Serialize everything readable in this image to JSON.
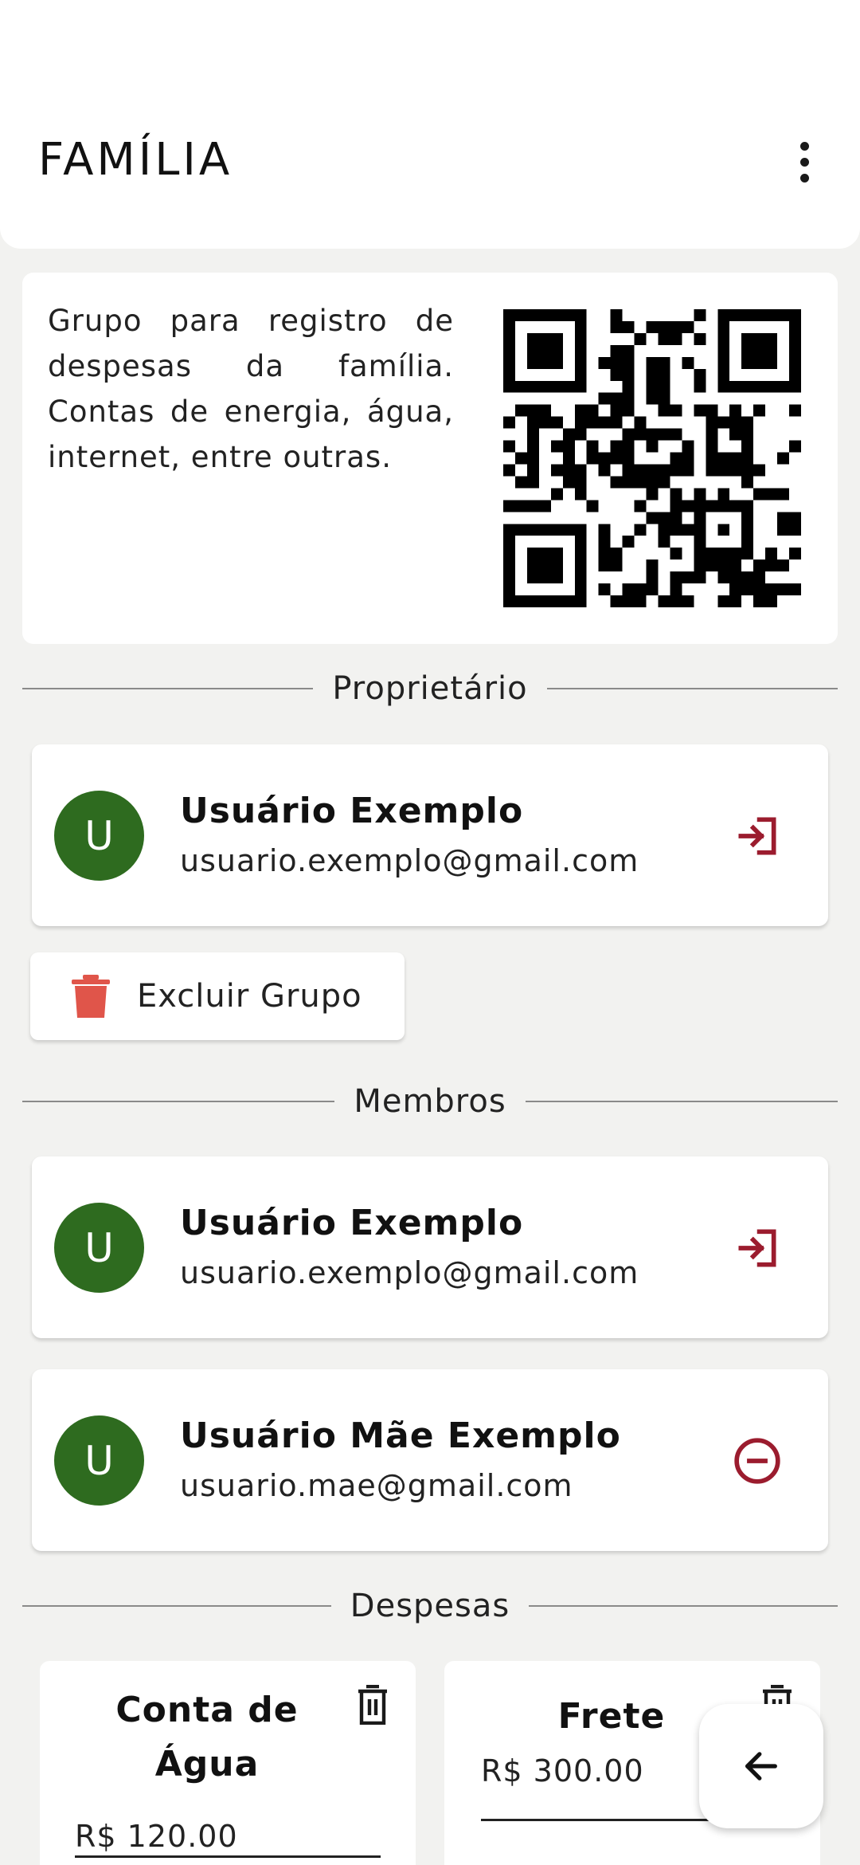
{
  "app_bar": {
    "title": "FAMÍLIA",
    "menu_icon": "more-vert-icon"
  },
  "group": {
    "description": "Grupo para registro de despesas da família. Contas de energia, água, internet, entre outras.",
    "qr_icon": "qr-code"
  },
  "sections": {
    "owner": "Proprietário",
    "members": "Membros",
    "expenses": "Despesas"
  },
  "owner": {
    "initial": "U",
    "name": "Usuário Exemplo",
    "email": "usuario.exemplo@gmail.com",
    "action_icon": "exit-icon"
  },
  "delete_group": {
    "label": "Excluir Grupo",
    "icon": "trash-icon"
  },
  "members": [
    {
      "initial": "U",
      "name": "Usuário Exemplo",
      "email": "usuario.exemplo@gmail.com",
      "action_icon": "exit-icon"
    },
    {
      "initial": "U",
      "name": "Usuário Mãe Exemplo",
      "email": "usuario.mae@gmail.com",
      "action_icon": "remove-circle-icon"
    }
  ],
  "expenses": [
    {
      "title": "Conta de Água",
      "value": "R$ 120.00"
    },
    {
      "title": "Frete",
      "value": "R$ 300.00"
    }
  ],
  "fab": {
    "icon": "arrow-back-icon"
  },
  "colors": {
    "avatar": "#2e6b1f",
    "action": "#9b1c2e",
    "delete": "#e0554a",
    "background": "#f2f2f0"
  }
}
